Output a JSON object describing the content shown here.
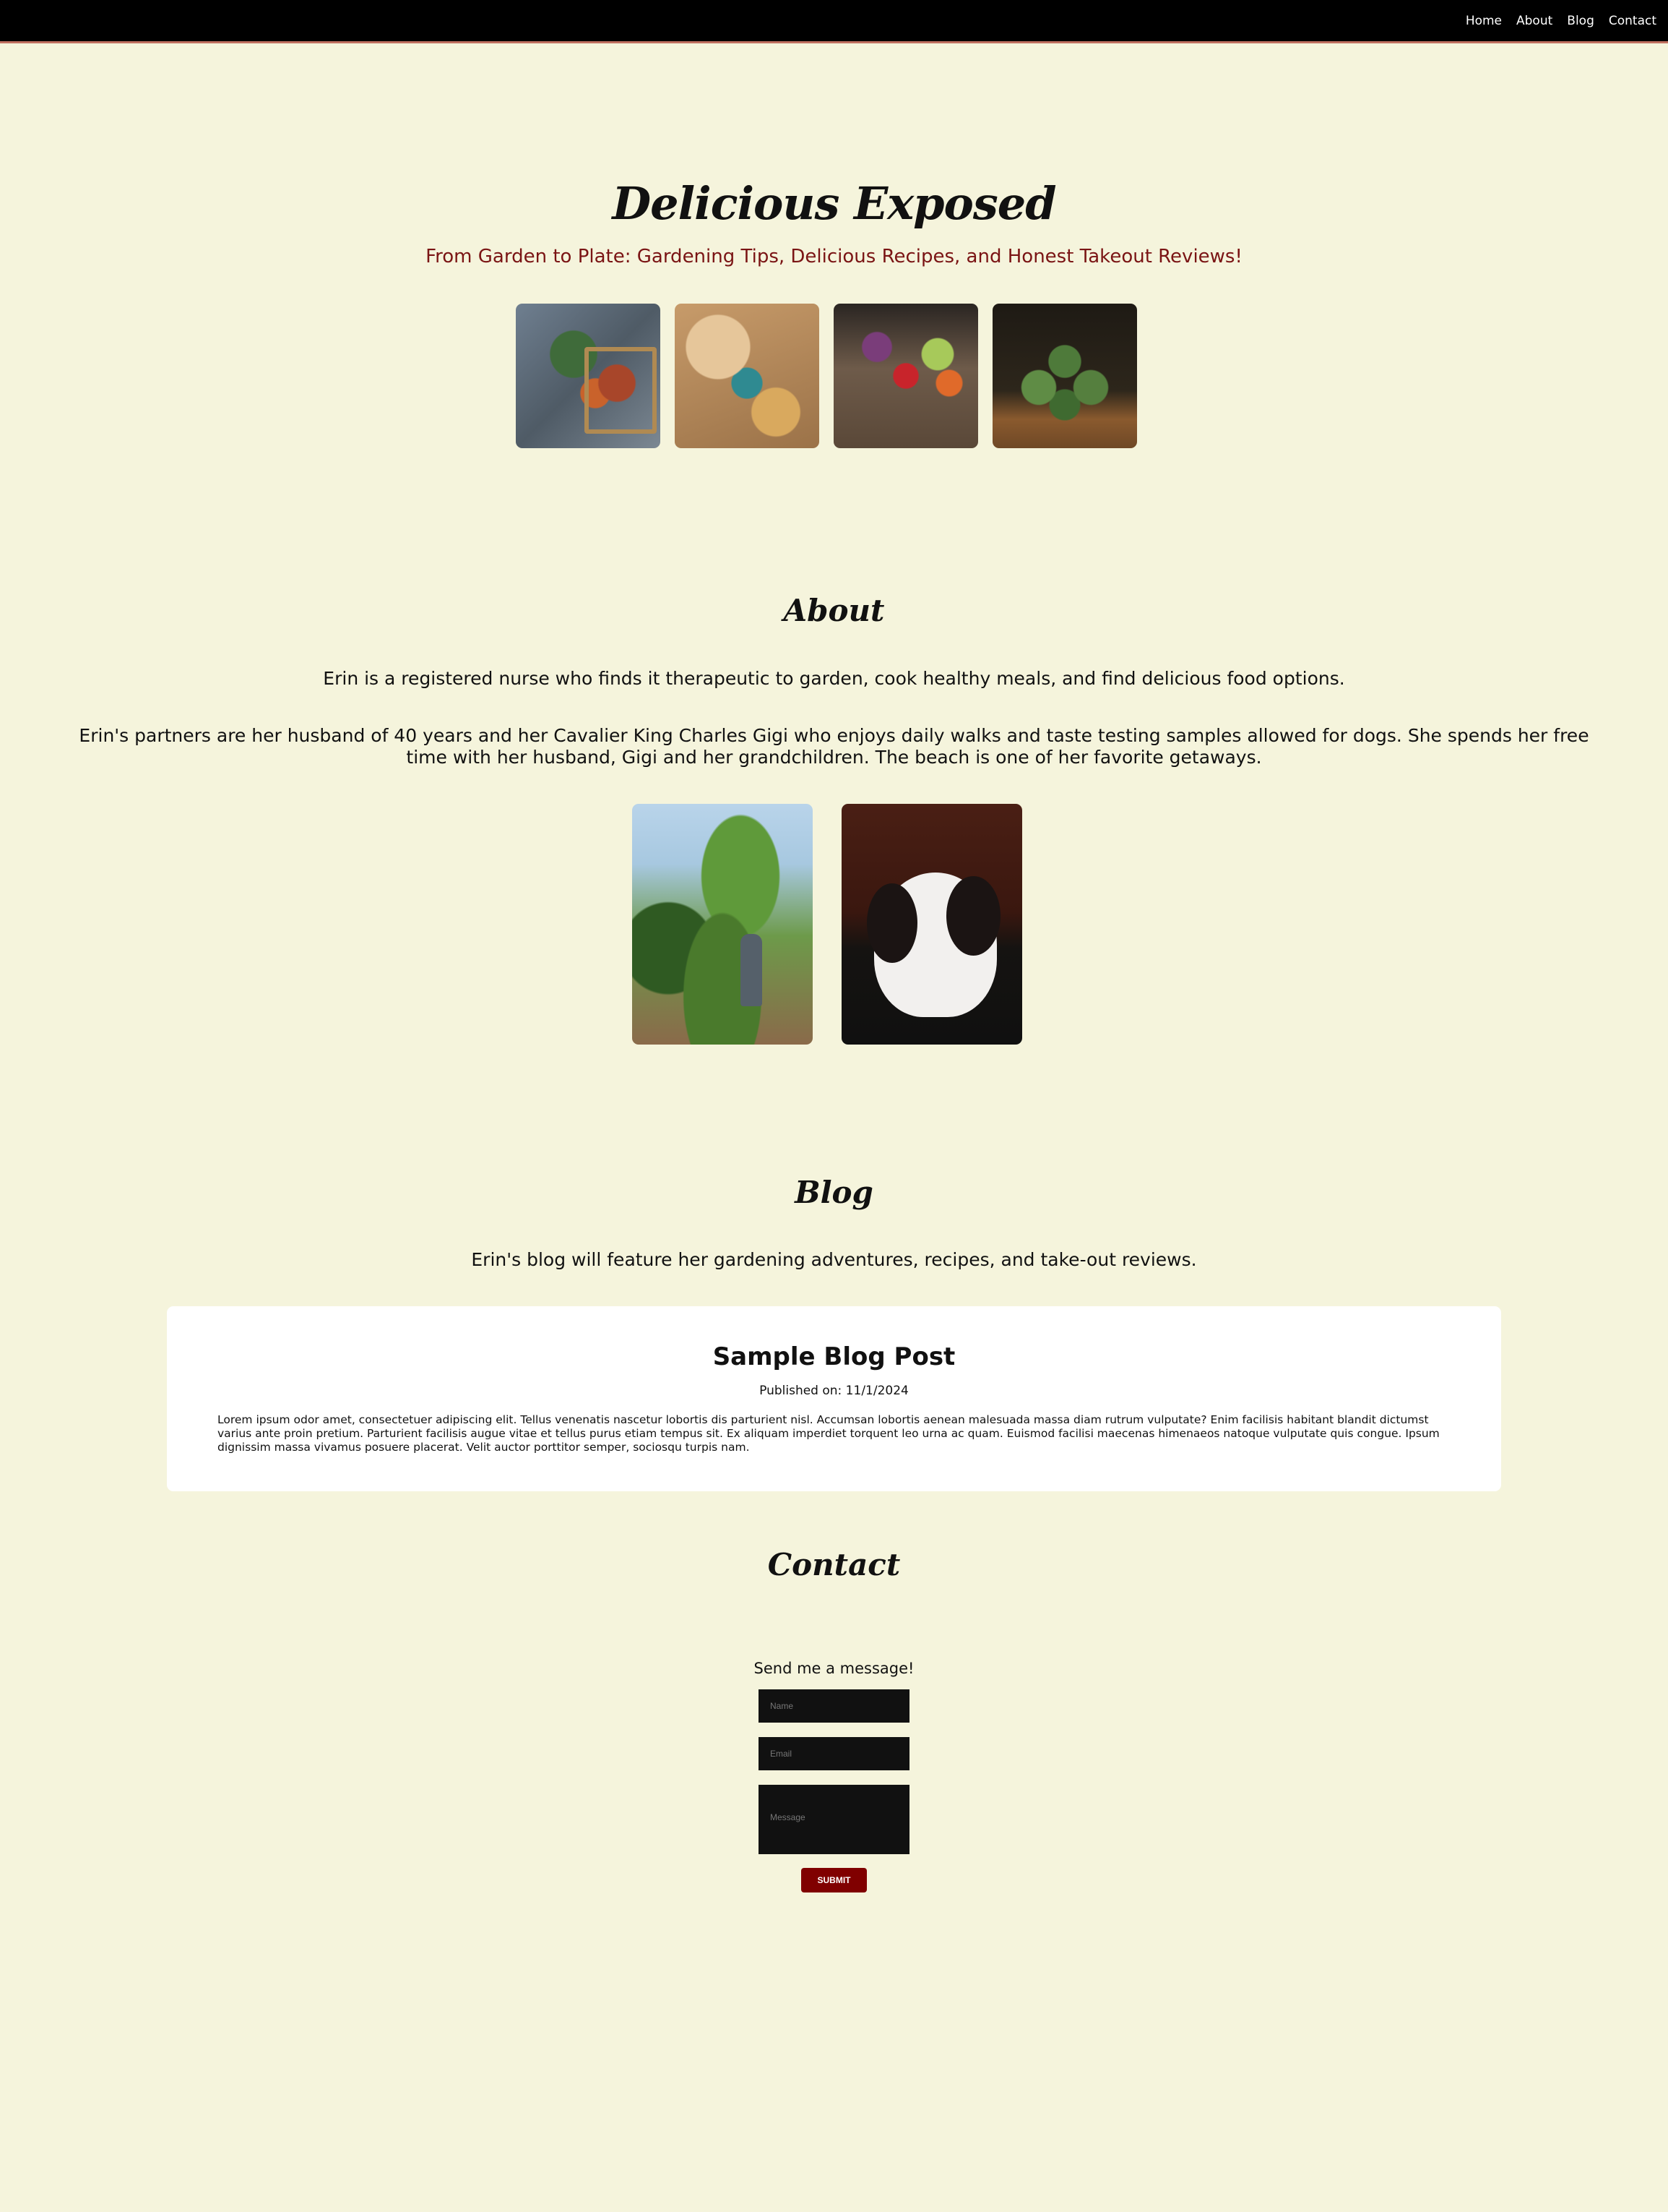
{
  "nav": {
    "items": [
      "Home",
      "About",
      "Blog",
      "Contact"
    ]
  },
  "hero": {
    "title": "Delicious Exposed",
    "subtitle": "From Garden to Plate: Gardening Tips, Delicious Recipes, and Honest Takeout Reviews!"
  },
  "about": {
    "title": "About",
    "p1": "Erin is a registered nurse who finds it therapeutic to garden, cook healthy meals, and find delicious food options.",
    "p2": "Erin's partners are her husband of 40 years and her Cavalier King Charles Gigi who enjoys daily walks and taste testing samples allowed for dogs. She spends her free time with her husband, Gigi and her grandchildren. The beach is one of her favorite getaways."
  },
  "blog": {
    "title": "Blog",
    "intro": "Erin's blog will feature her gardening adventures, recipes, and take-out reviews.",
    "post": {
      "title": "Sample Blog Post",
      "published": "Published on: 11/1/2024",
      "body": "Lorem ipsum odor amet, consectetuer adipiscing elit. Tellus venenatis nascetur lobortis dis parturient nisl. Accumsan lobortis aenean malesuada massa diam rutrum vulputate? Enim facilisis habitant blandit dictumst varius ante proin pretium. Parturient facilisis augue vitae et tellus purus etiam tempus sit. Ex aliquam imperdiet torquent leo urna ac quam. Euismod facilisi maecenas himenaeos natoque vulputate quis congue. Ipsum dignissim massa vivamus posuere placerat. Velit auctor porttitor semper, sociosqu turpis nam."
    }
  },
  "contact": {
    "title": "Contact",
    "lead": "Send me a message!",
    "name_placeholder": "Name",
    "email_placeholder": "Email",
    "message_placeholder": "Message",
    "submit_label": "SUBMIT"
  },
  "colors": {
    "background": "#f5f4dc",
    "nav": "#000000",
    "accent": "#800000",
    "subtitle": "#7a1414"
  }
}
